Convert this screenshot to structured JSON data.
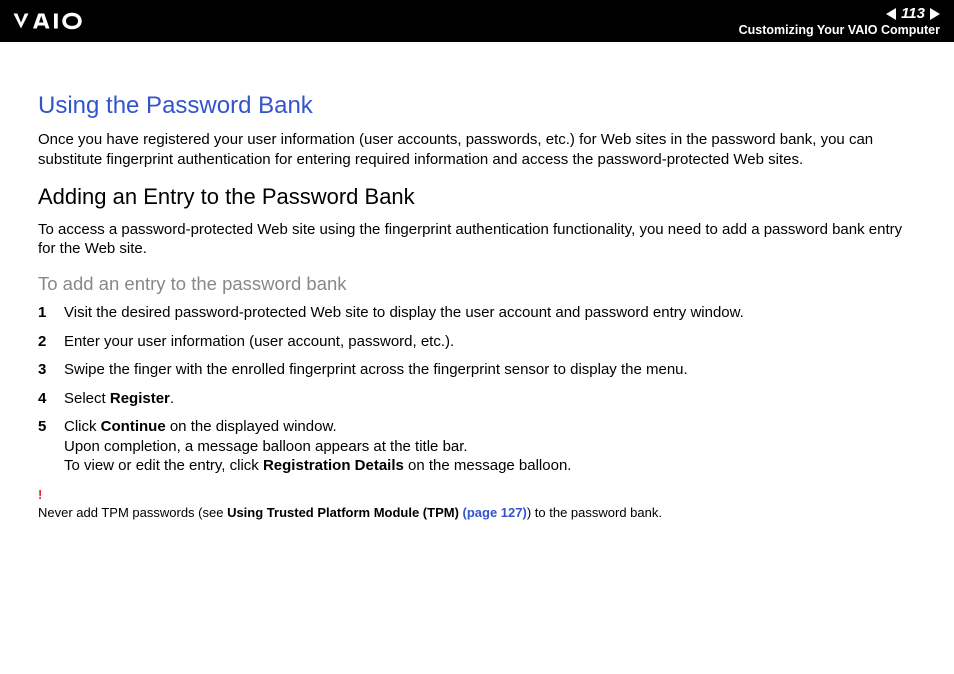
{
  "header": {
    "page_number": "113",
    "section": "Customizing Your VAIO Computer"
  },
  "content": {
    "h1": "Using the Password Bank",
    "intro": "Once you have registered your user information (user accounts, passwords, etc.) for Web sites in the password bank, you can substitute fingerprint authentication for entering required information and access the password-protected Web sites.",
    "h2": "Adding an Entry to the Password Bank",
    "para2": "To access a password-protected Web site using the fingerprint authentication functionality, you need to add a password bank entry for the Web site.",
    "h3": "To add an entry to the password bank",
    "steps": [
      {
        "num": "1",
        "text": "Visit the desired password-protected Web site to display the user account and password entry window."
      },
      {
        "num": "2",
        "text": "Enter your user information (user account, password, etc.)."
      },
      {
        "num": "3",
        "text": "Swipe the finger with the enrolled fingerprint across the fingerprint sensor to display the menu."
      },
      {
        "num": "4",
        "pre": "Select ",
        "bold": "Register",
        "post": "."
      },
      {
        "num": "5",
        "pre": "Click ",
        "bold": "Continue",
        "post": " on the displayed window.",
        "sub1": "Upon completion, a message balloon appears at the title bar.",
        "sub2_pre": "To view or edit the entry, click ",
        "sub2_bold": "Registration Details",
        "sub2_post": " on the message balloon."
      }
    ],
    "note_mark": "!",
    "note_pre": "Never add TPM passwords (see ",
    "note_bold": "Using Trusted Platform Module (TPM) ",
    "note_link": "(page 127)",
    "note_post": ") to the password bank."
  }
}
